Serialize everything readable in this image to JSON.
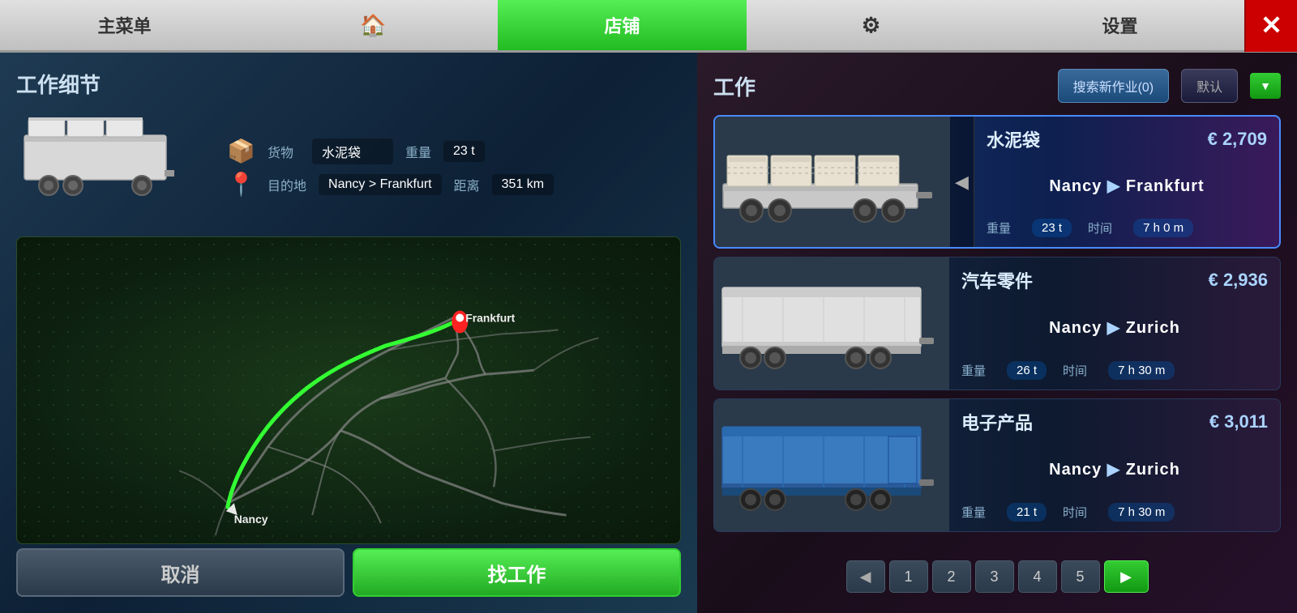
{
  "nav": {
    "items": [
      {
        "id": "main-menu",
        "label": "主菜单",
        "icon": ""
      },
      {
        "id": "home",
        "label": "🏠",
        "icon": "home"
      },
      {
        "id": "shop",
        "label": "店铺",
        "active": true
      },
      {
        "id": "settings-gear",
        "label": "⚙",
        "icon": "gear"
      },
      {
        "id": "settings",
        "label": "设置"
      }
    ],
    "close_label": "✕"
  },
  "left_panel": {
    "title": "工作细节",
    "cargo": {
      "label": "货物",
      "value": "水泥袋",
      "weight_label": "重量",
      "weight_value": "23 t",
      "destination_label": "目的地",
      "destination_value": "Nancy > Frankfurt",
      "distance_label": "距离",
      "distance_value": "351 km"
    },
    "map": {
      "label_frankfurt": "Frankfurt",
      "label_nancy": "Nancy"
    },
    "buttons": {
      "cancel": "取消",
      "find": "找工作"
    }
  },
  "right_panel": {
    "title": "工作",
    "search_btn": "搜索新作业(0)",
    "default_btn": "默认",
    "jobs": [
      {
        "id": 1,
        "cargo": "水泥袋",
        "price": "€ 2,709",
        "from": "Nancy",
        "to": "Frankfurt",
        "weight": "23 t",
        "time": "7 h 0 m",
        "trailer_type": "flat",
        "selected": true
      },
      {
        "id": 2,
        "cargo": "汽车零件",
        "price": "€ 2,936",
        "from": "Nancy",
        "to": "Zurich",
        "weight": "26 t",
        "time": "7 h 30 m",
        "trailer_type": "box-white",
        "selected": false
      },
      {
        "id": 3,
        "cargo": "电子产品",
        "price": "€ 3,011",
        "from": "Nancy",
        "to": "Zurich",
        "weight": "21 t",
        "time": "7 h 30 m",
        "trailer_type": "box-blue",
        "selected": false
      }
    ],
    "pagination": {
      "prev_label": "◀",
      "pages": [
        "1",
        "2",
        "3",
        "4",
        "5"
      ],
      "next_label": "▶"
    },
    "labels": {
      "weight": "重量",
      "time": "时间"
    }
  }
}
